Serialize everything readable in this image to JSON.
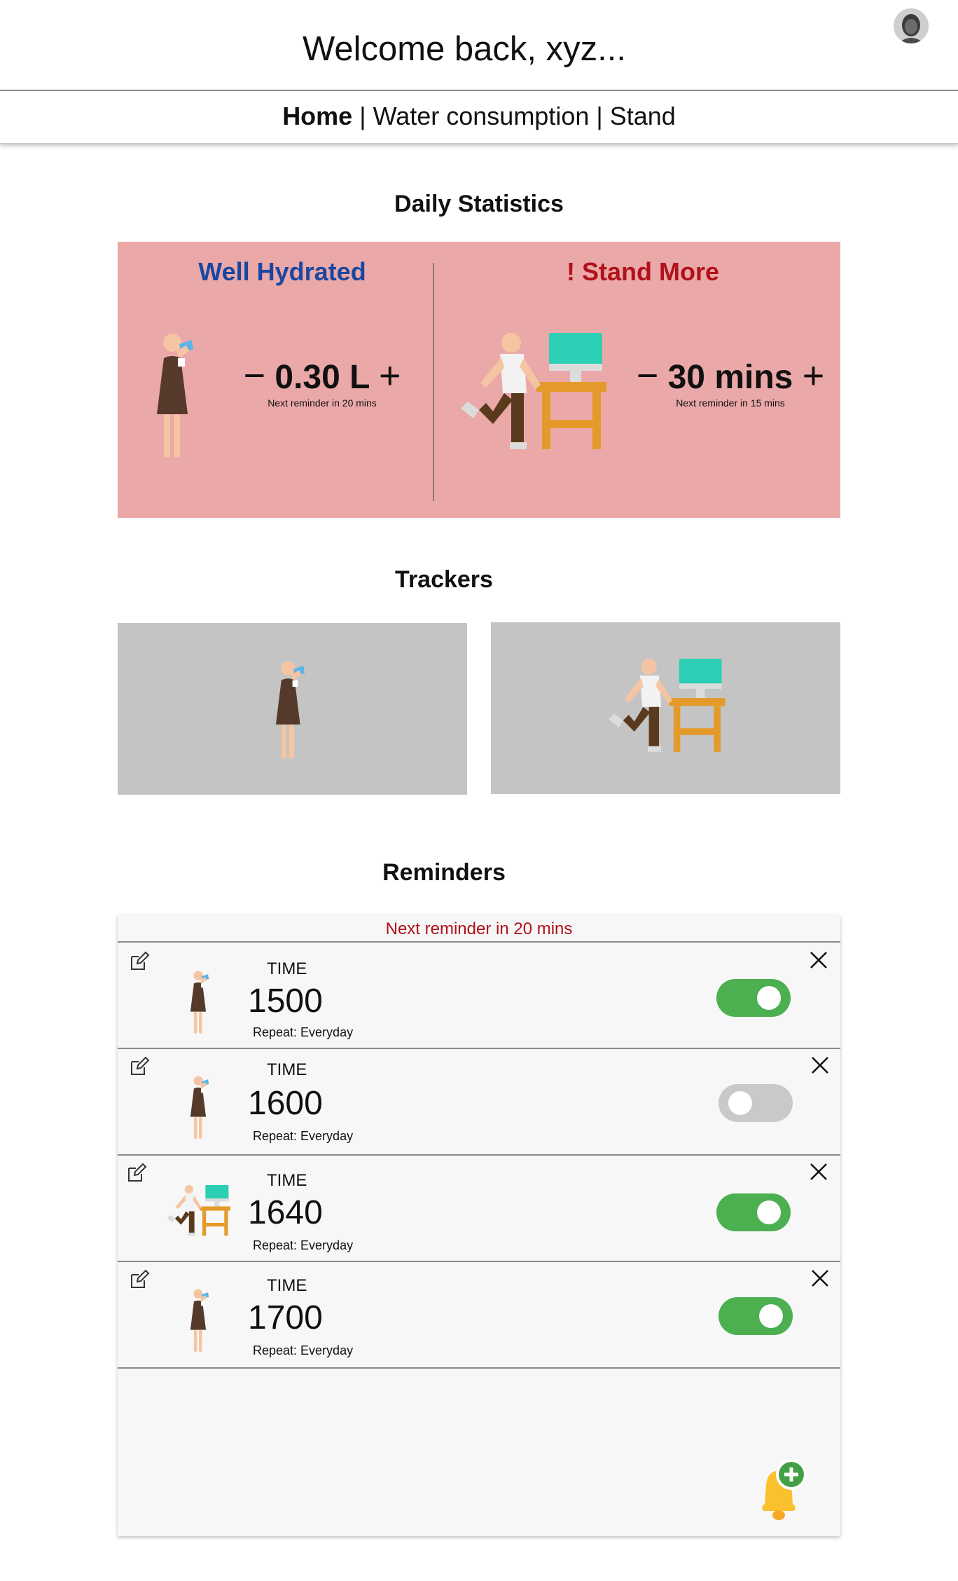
{
  "header": {
    "welcome": "Welcome back, xyz...",
    "nav": [
      {
        "label": "Home",
        "active": true
      },
      {
        "label": "Water consumption",
        "active": false
      },
      {
        "label": "Stand",
        "active": false
      }
    ]
  },
  "daily_statistics": {
    "title": "Daily Statistics",
    "hydration": {
      "status": "Well Hydrated",
      "value": "0.30 L",
      "next_reminder": "Next reminder in 20 mins",
      "status_color": "#1a47a0",
      "icon": "drinking-person-icon"
    },
    "stand": {
      "status": "! Stand More",
      "value": "30 mins",
      "next_reminder": "Next reminder in 15 mins",
      "status_color": "#b0121a",
      "icon": "standing-desk-person-icon"
    },
    "minus": "−",
    "plus": "+"
  },
  "trackers": {
    "title": "Trackers",
    "items": [
      {
        "icon": "drinking-person-icon"
      },
      {
        "icon": "standing-desk-person-icon"
      }
    ]
  },
  "reminders": {
    "title": "Reminders",
    "next_reminder": "Next reminder in 20 mins",
    "time_label": "TIME",
    "items": [
      {
        "time": "1500",
        "repeat": "Repeat: Everyday",
        "enabled": true,
        "icon": "drinking-person-icon"
      },
      {
        "time": "1600",
        "repeat": "Repeat: Everyday",
        "enabled": false,
        "icon": "drinking-person-icon"
      },
      {
        "time": "1640",
        "repeat": "Repeat: Everyday",
        "enabled": true,
        "icon": "standing-desk-person-icon"
      },
      {
        "time": "1700",
        "repeat": "Repeat: Everyday",
        "enabled": true,
        "icon": "drinking-person-icon"
      }
    ],
    "add_icon": "add-reminder-bell-icon"
  },
  "colors": {
    "stats_bg": "#eba8a8",
    "tracker_bg": "#c4c4c4",
    "toggle_on": "#4caf50",
    "toggle_off": "#c9c9c9",
    "bell": "#fbc02d"
  }
}
